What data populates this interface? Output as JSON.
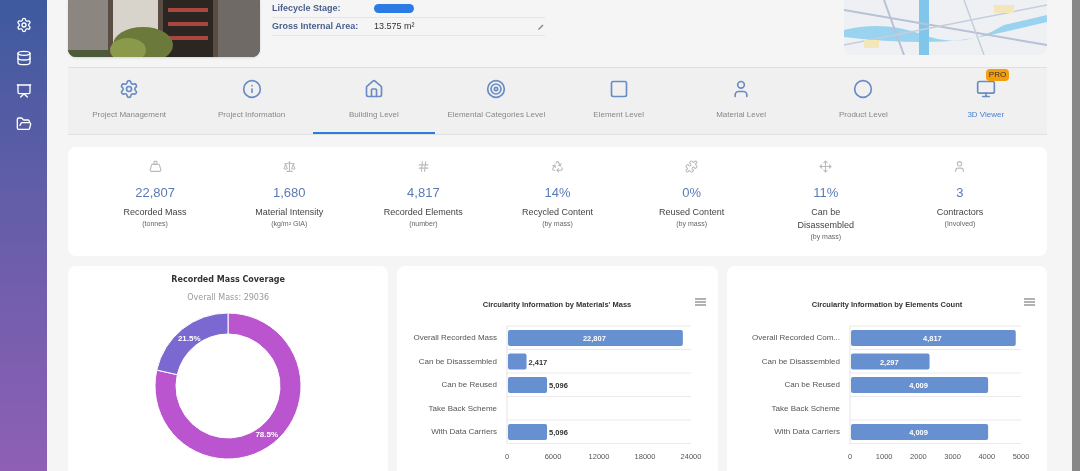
{
  "project": {
    "fields": [
      {
        "label": "Lifecycle Stage:",
        "kind": "pill"
      },
      {
        "label": "Gross Internal Area:",
        "value": "13.575 m²",
        "kind": "text"
      }
    ]
  },
  "tabs": [
    {
      "label": "Project Management",
      "selected": false,
      "accent": false
    },
    {
      "label": "Project Information",
      "selected": false,
      "accent": false
    },
    {
      "label": "Building Level",
      "selected": true,
      "accent": false
    },
    {
      "label": "Elemental Categories Level",
      "selected": false,
      "accent": false
    },
    {
      "label": "Element Level",
      "selected": false,
      "accent": false
    },
    {
      "label": "Material Level",
      "selected": false,
      "accent": false
    },
    {
      "label": "Product Level",
      "selected": false,
      "accent": false
    },
    {
      "label": "3D Viewer",
      "selected": false,
      "accent": true,
      "badge": "PRO"
    }
  ],
  "stats": [
    {
      "value": "22,807",
      "label": "Recorded Mass",
      "unit": "(tonnes)"
    },
    {
      "value": "1,680",
      "label": "Material Intensity",
      "unit": "(kg/m² GIA)"
    },
    {
      "value": "4,817",
      "label": "Recorded Elements",
      "unit": "(number)"
    },
    {
      "value": "14%",
      "label": "Recycled Content",
      "unit": "(by mass)"
    },
    {
      "value": "0%",
      "label": "Reused Content",
      "unit": "(by mass)"
    },
    {
      "value": "11%",
      "label": "Can be Disassembled",
      "unit": "(by mass)"
    },
    {
      "value": "3",
      "label": "Contractors",
      "unit": "(Involved)"
    }
  ],
  "charts": [
    {
      "subtitle": "Overall Mass: 29036",
      "chart_data": {
        "type": "donut",
        "title": "Recorded Mass Coverage",
        "values": [
          78.5,
          21.5
        ],
        "colors": [
          "#bb55cf",
          "#7b68d0"
        ],
        "value_labels": [
          "78.5%",
          "21.5%"
        ]
      }
    },
    {
      "chart_data": {
        "type": "bar",
        "orientation": "horizontal",
        "title": "Circularity Information by Materials' Mass",
        "categories": [
          "Overall Recorded Mass",
          "Can be Disassembled",
          "Can be Reused",
          "Take Back Scheme",
          "With Data Carriers"
        ],
        "series": [
          {
            "color": "#6690d0",
            "values": [
              22807,
              2417,
              5096,
              null,
              5096
            ]
          }
        ],
        "xlim": [
          0,
          24000
        ],
        "xticks": [
          0,
          6000,
          12000,
          18000,
          24000
        ],
        "value_labels": [
          "22,807",
          "2,417",
          "5,096",
          null,
          "5,096"
        ]
      }
    },
    {
      "chart_data": {
        "type": "bar",
        "orientation": "horizontal",
        "title": "Circularity Information by Elements Count",
        "categories": [
          "Overall Recorded Com...",
          "Can be Disassembled",
          "Can be Reused",
          "Take Back Scheme",
          "With Data Carriers"
        ],
        "series": [
          {
            "color": "#6690d0",
            "values": [
              4817,
              2297,
              4009,
              null,
              4009
            ]
          }
        ],
        "xlim": [
          0,
          5000
        ],
        "xticks": [
          0,
          1000,
          2000,
          3000,
          4000,
          5000
        ],
        "value_labels": [
          "4,817",
          "2,297",
          "4,009",
          null,
          "4,009"
        ]
      }
    }
  ]
}
